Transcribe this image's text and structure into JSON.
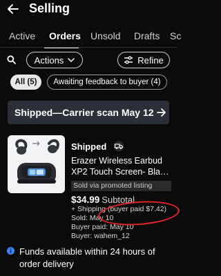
{
  "header": {
    "title": "Selling"
  },
  "tabs": [
    {
      "label": "Active"
    },
    {
      "label": "Orders"
    },
    {
      "label": "Unsold"
    },
    {
      "label": "Drafts"
    },
    {
      "label": "Sc"
    }
  ],
  "filters": {
    "actions_label": "Actions",
    "refine_label": "Refine",
    "chips": [
      {
        "label": "All (5)"
      },
      {
        "label": "Awaiting feedback to buyer (4)"
      }
    ]
  },
  "section": {
    "title": "Shipped—Carrier scan May 12"
  },
  "order": {
    "status": "Shipped",
    "title_line1": "Erazer Wireless Earbud",
    "title_line2": "XP2 Touch Screen- Bla…",
    "promoted": "Sold via promoted listing",
    "price": "$34.99",
    "subtotal_label": "Subtotal",
    "shipping": "+ Shipping (buyer paid $7.42)",
    "sold": "Sold: May 10",
    "buyer_paid": "Buyer paid: May 10",
    "buyer": "Buyer: wahem_12"
  },
  "info": {
    "text": "Funds available within 24 hours of order delivery"
  },
  "colors": {
    "background": "#0b0b0b",
    "banner": "#2a2f38",
    "info": "#3b82f6",
    "annotation": "#e3262a"
  }
}
